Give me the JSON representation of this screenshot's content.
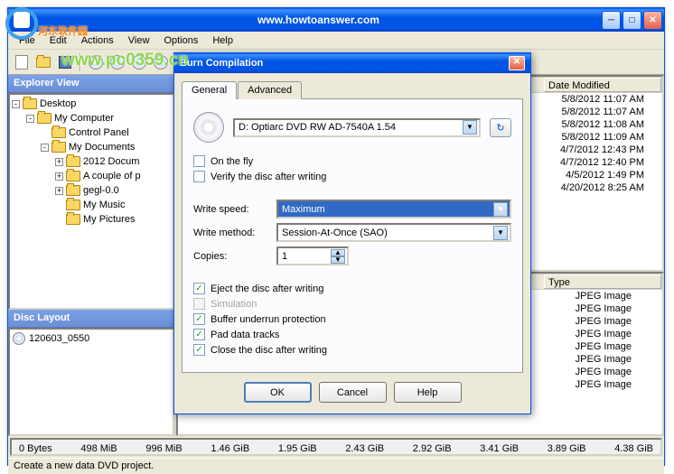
{
  "watermark1": "河东软件园",
  "watermark2": "www.pc0359.cn",
  "window": {
    "title": "www.howtoanswer.com",
    "min": "0",
    "max": "1",
    "close": "r"
  },
  "menu": {
    "file": "File",
    "edit": "Edit",
    "actions": "Actions",
    "view": "View",
    "options": "Options",
    "help": "Help"
  },
  "explorer": {
    "header": "Explorer View",
    "items": [
      {
        "indent": 0,
        "toggle": "-",
        "icon": "desktop",
        "label": "Desktop"
      },
      {
        "indent": 1,
        "toggle": "-",
        "icon": "computer",
        "label": "My Computer"
      },
      {
        "indent": 2,
        "toggle": "",
        "icon": "folder",
        "label": "Control Panel"
      },
      {
        "indent": 2,
        "toggle": "-",
        "icon": "folder-open",
        "label": "My Documents"
      },
      {
        "indent": 3,
        "toggle": "+",
        "icon": "folder",
        "label": "2012 Docum"
      },
      {
        "indent": 3,
        "toggle": "+",
        "icon": "folder",
        "label": "A couple of p"
      },
      {
        "indent": 3,
        "toggle": "+",
        "icon": "folder",
        "label": "gegl-0.0"
      },
      {
        "indent": 3,
        "toggle": "",
        "icon": "folder",
        "label": "My Music"
      },
      {
        "indent": 3,
        "toggle": "",
        "icon": "folder",
        "label": "My Pictures"
      }
    ]
  },
  "disc_layout": {
    "header": "Disc Layout",
    "item": "120603_0550"
  },
  "file_list": {
    "date_col": "Date Modified",
    "dates": [
      "5/8/2012 11:07 AM",
      "5/8/2012 11:07 AM",
      "5/8/2012 11:08 AM",
      "5/8/2012 11:09 AM",
      "4/7/2012 12:43 PM",
      "4/7/2012 12:40 PM",
      "4/5/2012 1:49 PM",
      "4/20/2012 8:25 AM"
    ],
    "type_col": "Type",
    "types": [
      "JPEG Image",
      "JPEG Image",
      "JPEG Image",
      "JPEG Image",
      "JPEG Image",
      "JPEG Image",
      "JPEG Image",
      "JPEG Image"
    ]
  },
  "ruler": [
    "0 Bytes",
    "498 MiB",
    "996 MiB",
    "1.46 GiB",
    "1.95 GiB",
    "2.43 GiB",
    "2.92 GiB",
    "3.41 GiB",
    "3.89 GiB",
    "4.38 GiB"
  ],
  "status": "Create a new data DVD project.",
  "dialog": {
    "title": "Burn Compilation",
    "tabs": {
      "general": "General",
      "advanced": "Advanced"
    },
    "device": "D: Optiarc DVD RW AD-7540A 1.54",
    "on_the_fly": "On the fly",
    "verify": "Verify the disc after writing",
    "write_speed_lbl": "Write speed:",
    "write_speed_val": "Maximum",
    "write_method_lbl": "Write method:",
    "write_method_val": "Session-At-Once (SAO)",
    "copies_lbl": "Copies:",
    "copies_val": "1",
    "eject": "Eject the disc after writing",
    "simulation": "Simulation",
    "buffer": "Buffer underrun protection",
    "pad": "Pad data tracks",
    "close_disc": "Close the disc after writing",
    "ok": "OK",
    "cancel": "Cancel",
    "help": "Help"
  }
}
